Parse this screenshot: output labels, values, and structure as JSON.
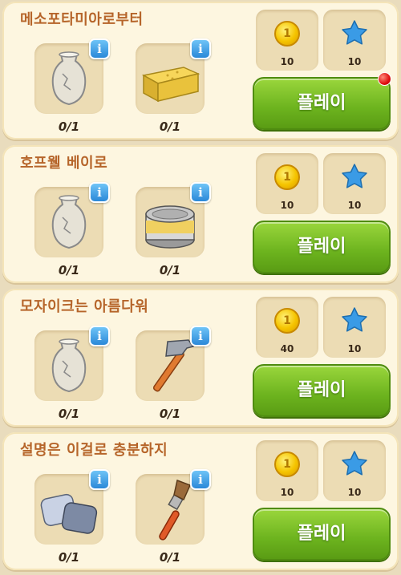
{
  "levels": [
    {
      "title": "메소포타미아로부터",
      "items": [
        {
          "icon": "vase-icon",
          "count": "0/1"
        },
        {
          "icon": "sponge-icon",
          "count": "0/1"
        }
      ],
      "rewards": {
        "coins": "10",
        "stars": "10"
      },
      "play_label": "플레이",
      "notification": true
    },
    {
      "title": "호프웰 베이로",
      "items": [
        {
          "icon": "vase-icon",
          "count": "0/1"
        },
        {
          "icon": "paint-can-icon",
          "count": "0/1"
        }
      ],
      "rewards": {
        "coins": "10",
        "stars": "10"
      },
      "play_label": "플레이"
    },
    {
      "title": "모자이크는 아름다워",
      "items": [
        {
          "icon": "vase-icon",
          "count": "0/1"
        },
        {
          "icon": "hammer-icon",
          "count": "0/1"
        }
      ],
      "rewards": {
        "coins": "40",
        "stars": "10"
      },
      "play_label": "플레이"
    },
    {
      "title": "설명은 이걸로 충분하지",
      "items": [
        {
          "icon": "tiles-icon",
          "count": "0/1"
        },
        {
          "icon": "paintbrush-icon",
          "count": "0/1"
        }
      ],
      "rewards": {
        "coins": "10",
        "stars": "10"
      },
      "play_label": "플레이"
    }
  ],
  "info_glyph": "i",
  "coin_glyph": "1",
  "colors": {
    "title": "#b6652a",
    "play_button": "#7dc12a",
    "info_badge": "#3a9be6",
    "star": "#3a9be6",
    "coin": "#f5c400"
  }
}
